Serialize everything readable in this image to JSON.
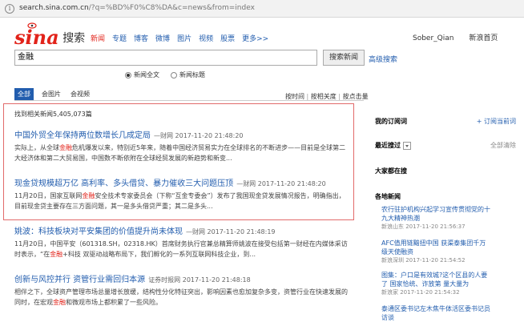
{
  "browser": {
    "url_host": "search.sina.com.cn",
    "url_path": "/?q=%BD%F0%C8%DA&c=news&from=index"
  },
  "header": {
    "logo_brand": "sina",
    "logo_text": "搜索",
    "nav": [
      "新闻",
      "专题",
      "博客",
      "微博",
      "图片",
      "视频",
      "股票",
      "更多>>"
    ],
    "active_nav": 0,
    "user_name": "Sober_Qian",
    "home_link": "新浪首页"
  },
  "search": {
    "query": "金融",
    "button": "搜索新闻",
    "advanced": "高级搜索",
    "options": [
      "新闻全文",
      "新闻标题"
    ],
    "selected_option": 0
  },
  "tabs": {
    "items": [
      "全部",
      "会图片",
      "会视频"
    ],
    "active": 0,
    "sorts": [
      "按时间",
      "按相关度",
      "按点击量"
    ]
  },
  "results": {
    "count_text": "找到相关新闻5,405,073篇",
    "items": [
      {
        "title": "中国外贸全年保持两位数增长几成定局",
        "meta": "—财网 2017-11-20 21:48:20",
        "summary_pre": "实际上，从全球",
        "summary_hl": "金融",
        "summary_post": "危机爆发以来，特别近5年来，随着中国经济贸易实力在全球排名的不断进步——目前是全球第二大经济体和第二大贸易国，中国数不断依附在全球经贸发展的新趋势和新变..."
      },
      {
        "title": "现金贷规模超万亿 高利率、多头借贷、暴力催收三大问题压顶",
        "meta": "—财网 2017-11-20 21:48:20",
        "summary_pre": "11月20日，国家互联网",
        "summary_hl": "金融",
        "summary_post": "安全技术专家委员会（下称“互金专委会”）发布了我国现金贷发展情况报告，明确指出，目前现金贷主要存在三方面问题，其一是多头借贷严重；其二是多头..."
      },
      {
        "title": "姚波：科技板块对平安集团的价值提升尚未体现",
        "meta": "—财网 2017-11-20 21:48:19",
        "summary_pre": "11月20日，中国平安（601318.SH，02318.HK）首席财务执行官兼总精算师姚波在接受包括第一财经在内媒体采访时表示，“在",
        "summary_hl": "金融",
        "summary_post": "+科技 双驱动战略布局下，我们孵化的一系列互联网科技企业，到..."
      },
      {
        "title": "创新与风控并行 资管行业需回归本源",
        "meta": "证券时报网 2017-11-20 21:48:18",
        "summary_pre": "相伴之下，全球资产管理市场总量增长放缓，结构性分化特征突出，影响因素也愈加复杂多变，资管行业在快速发展的同时，在宏观",
        "summary_hl": "金融",
        "summary_post": "和微观市场上都积累了一些风险。"
      }
    ]
  },
  "sidebar": {
    "subscription_title": "我的订阅词",
    "subscription_add": "+ 订阅当前词",
    "recent_title": "最近搜过",
    "recent_clear": "全部清除",
    "hot_title": "大家都在搜",
    "photo_title": "各地新闻",
    "photo_news": [
      {
        "title": "农行驻护机构兴起学习宣传贯彻党的十九大精神热潮",
        "meta": "新浪山东 2017-11-20 21:56:37"
      },
      {
        "title": "AFC值用链黯扭中国 获渠泰集团千万级天使融资",
        "meta": "新浪深圳 2017-11-20 21:54:52"
      },
      {
        "title": "图集：户口是有效城?这个区县的人要了 国家恰统、诈放第 量大量为",
        "meta": "新浪家 2017-11-20 21:54:32"
      },
      {
        "title": "泰通区委书记左木焦牛体活区委书记员 访谈"
      }
    ]
  },
  "colors": {
    "brand": "#e2231a",
    "link": "#225dae",
    "highlight_box": "#e26a6a"
  }
}
